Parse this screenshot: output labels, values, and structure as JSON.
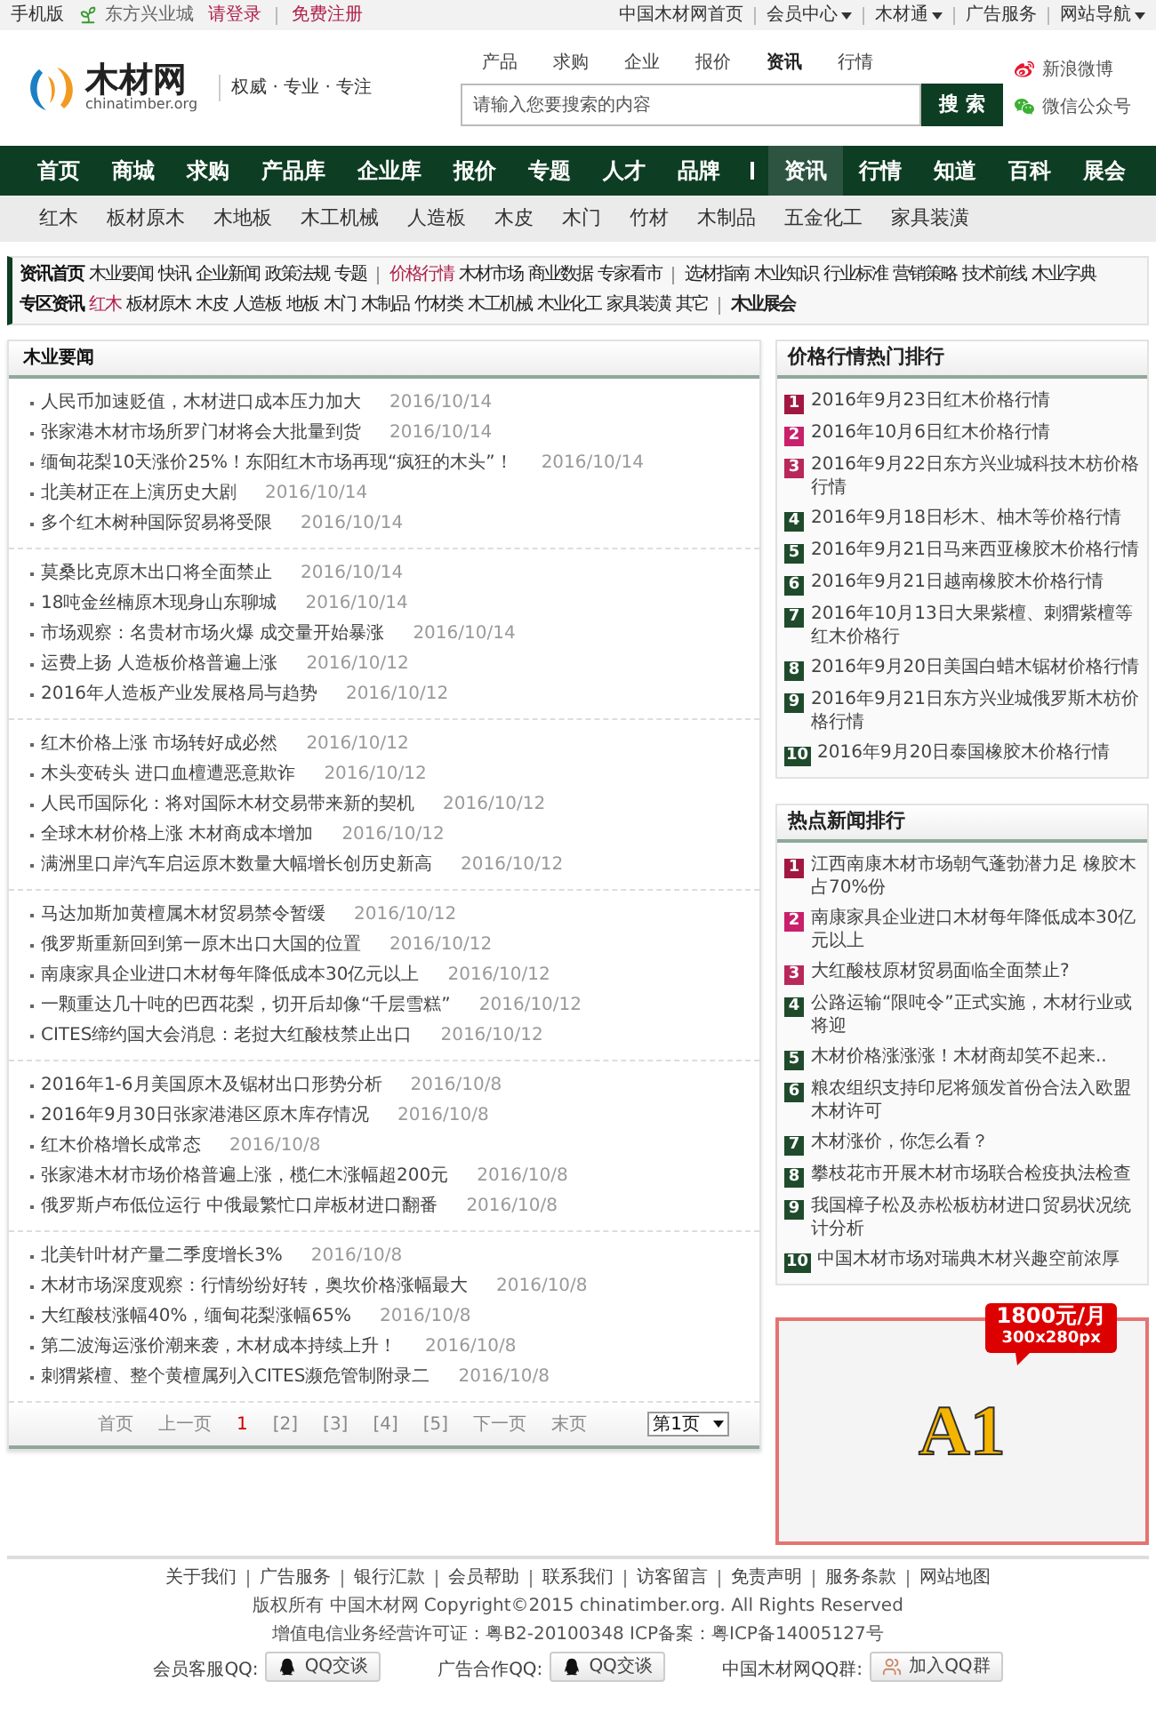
{
  "top_bar": {
    "mobile": "手机版",
    "store": "东方兴业城",
    "login": "请登录",
    "register": "免费注册",
    "links": [
      {
        "label": "中国木材网首页",
        "dropdown": false
      },
      {
        "label": "会员中心",
        "dropdown": true
      },
      {
        "label": "木材通",
        "dropdown": true
      },
      {
        "label": "广告服务",
        "dropdown": false
      },
      {
        "label": "网站导航",
        "dropdown": true
      }
    ]
  },
  "header": {
    "logo": {
      "name": "木材网",
      "domain": "chinatimber.org"
    },
    "slogan": "权威 · 专业 · 专注",
    "search_tabs": [
      {
        "label": "产品",
        "selected": false
      },
      {
        "label": "求购",
        "selected": false
      },
      {
        "label": "企业",
        "selected": false
      },
      {
        "label": "报价",
        "selected": false
      },
      {
        "label": "资讯",
        "selected": true
      },
      {
        "label": "行情",
        "selected": false
      }
    ],
    "search": {
      "placeholder": "请输入您要搜索的内容",
      "button": "搜 索"
    },
    "social": [
      {
        "kind": "weibo",
        "label": "新浪微博"
      },
      {
        "kind": "wechat",
        "label": "微信公众号"
      }
    ]
  },
  "main_nav": [
    {
      "kind": "link",
      "label": "首页",
      "selected": false
    },
    {
      "kind": "link",
      "label": "商城",
      "selected": false
    },
    {
      "kind": "link",
      "label": "求购",
      "selected": false
    },
    {
      "kind": "link",
      "label": "产品库",
      "selected": false
    },
    {
      "kind": "link",
      "label": "企业库",
      "selected": false
    },
    {
      "kind": "link",
      "label": "报价",
      "selected": false
    },
    {
      "kind": "link",
      "label": "专题",
      "selected": false
    },
    {
      "kind": "link",
      "label": "人才",
      "selected": false
    },
    {
      "kind": "link",
      "label": "品牌",
      "selected": false
    },
    {
      "kind": "divider"
    },
    {
      "kind": "link",
      "label": "资讯",
      "selected": true
    },
    {
      "kind": "link",
      "label": "行情",
      "selected": false
    },
    {
      "kind": "link",
      "label": "知道",
      "selected": false
    },
    {
      "kind": "link",
      "label": "百科",
      "selected": false
    },
    {
      "kind": "link",
      "label": "展会",
      "selected": false
    }
  ],
  "category_nav": [
    "红木",
    "板材原木",
    "木地板",
    "木工机械",
    "人造板",
    "木皮",
    "木门",
    "竹材",
    "木制品",
    "五金化工",
    "家具装潢"
  ],
  "channel_rows": [
    {
      "title": "资讯首页",
      "items": [
        {
          "kind": "link",
          "label": "木业要闻",
          "accent": false,
          "bold": false
        },
        {
          "kind": "link",
          "label": "快讯",
          "accent": false,
          "bold": false
        },
        {
          "kind": "link",
          "label": "企业新闻",
          "accent": false,
          "bold": false
        },
        {
          "kind": "link",
          "label": "政策法规",
          "accent": false,
          "bold": false
        },
        {
          "kind": "link",
          "label": "专题",
          "accent": false,
          "bold": false
        },
        {
          "kind": "divider"
        },
        {
          "kind": "link",
          "label": "价格行情",
          "accent": true,
          "bold": false
        },
        {
          "kind": "link",
          "label": "木材市场",
          "accent": false,
          "bold": false
        },
        {
          "kind": "link",
          "label": "商业数据",
          "accent": false,
          "bold": false
        },
        {
          "kind": "link",
          "label": "专家看市",
          "accent": false,
          "bold": false
        },
        {
          "kind": "divider"
        },
        {
          "kind": "link",
          "label": "选材指南",
          "accent": false,
          "bold": false
        },
        {
          "kind": "link",
          "label": "木业知识",
          "accent": false,
          "bold": false
        },
        {
          "kind": "link",
          "label": "行业标准",
          "accent": false,
          "bold": false
        },
        {
          "kind": "link",
          "label": "营销策略",
          "accent": false,
          "bold": false
        },
        {
          "kind": "link",
          "label": "技术前线",
          "accent": false,
          "bold": false
        },
        {
          "kind": "link",
          "label": "木业字典",
          "accent": false,
          "bold": false
        }
      ]
    },
    {
      "title": "专区资讯",
      "items": [
        {
          "kind": "link",
          "label": "红木",
          "accent": true,
          "bold": false
        },
        {
          "kind": "link",
          "label": "板材原木",
          "accent": false,
          "bold": false
        },
        {
          "kind": "link",
          "label": "木皮",
          "accent": false,
          "bold": false
        },
        {
          "kind": "link",
          "label": "人造板",
          "accent": false,
          "bold": false
        },
        {
          "kind": "link",
          "label": "地板",
          "accent": false,
          "bold": false
        },
        {
          "kind": "link",
          "label": "木门",
          "accent": false,
          "bold": false
        },
        {
          "kind": "link",
          "label": "木制品",
          "accent": false,
          "bold": false
        },
        {
          "kind": "link",
          "label": "竹材类",
          "accent": false,
          "bold": false
        },
        {
          "kind": "link",
          "label": "木工机械",
          "accent": false,
          "bold": false
        },
        {
          "kind": "link",
          "label": "木业化工",
          "accent": false,
          "bold": false
        },
        {
          "kind": "link",
          "label": "家具装潢",
          "accent": false,
          "bold": false
        },
        {
          "kind": "link",
          "label": "其它",
          "accent": false,
          "bold": false
        },
        {
          "kind": "divider"
        },
        {
          "kind": "link",
          "label": "木业展会",
          "accent": false,
          "bold": true
        }
      ]
    }
  ],
  "news": {
    "title": "木业要闻",
    "groups": [
      [
        {
          "title": "人民币加速贬值，木材进口成本压力加大",
          "date": "2016/10/14"
        },
        {
          "title": "张家港木材市场所罗门材将会大批量到货",
          "date": "2016/10/14"
        },
        {
          "title": "缅甸花梨10天涨价25%！东阳红木市场再现“疯狂的木头”！",
          "date": "2016/10/14"
        },
        {
          "title": "北美材正在上演历史大剧",
          "date": "2016/10/14"
        },
        {
          "title": "多个红木树种国际贸易将受限",
          "date": "2016/10/14"
        }
      ],
      [
        {
          "title": "莫桑比克原木出口将全面禁止",
          "date": "2016/10/14"
        },
        {
          "title": "18吨金丝楠原木现身山东聊城",
          "date": "2016/10/14"
        },
        {
          "title": "市场观察：名贵材市场火爆 成交量开始暴涨",
          "date": "2016/10/14"
        },
        {
          "title": "运费上扬 人造板价格普遍上涨",
          "date": "2016/10/12"
        },
        {
          "title": "2016年人造板产业发展格局与趋势",
          "date": "2016/10/12"
        }
      ],
      [
        {
          "title": "红木价格上涨 市场转好成必然",
          "date": "2016/10/12"
        },
        {
          "title": "木头变砖头 进口血檀遭恶意欺诈",
          "date": "2016/10/12"
        },
        {
          "title": "人民币国际化：将对国际木材交易带来新的契机",
          "date": "2016/10/12"
        },
        {
          "title": "全球木材价格上涨 木材商成本增加",
          "date": "2016/10/12"
        },
        {
          "title": "满洲里口岸汽车启运原木数量大幅增长创历史新高",
          "date": "2016/10/12"
        }
      ],
      [
        {
          "title": "马达加斯加黄檀属木材贸易禁令暂缓",
          "date": "2016/10/12"
        },
        {
          "title": "俄罗斯重新回到第一原木出口大国的位置",
          "date": "2016/10/12"
        },
        {
          "title": "南康家具企业进口木材每年降低成本30亿元以上",
          "date": "2016/10/12"
        },
        {
          "title": "一颗重达几十吨的巴西花梨，切开后却像“千层雪糕”",
          "date": "2016/10/12"
        },
        {
          "title": "CITES缔约国大会消息：老挝大红酸枝禁止出口",
          "date": "2016/10/12"
        }
      ],
      [
        {
          "title": "2016年1-6月美国原木及锯材出口形势分析",
          "date": "2016/10/8"
        },
        {
          "title": "2016年9月30日张家港港区原木库存情况",
          "date": "2016/10/8"
        },
        {
          "title": "红木价格增长成常态",
          "date": "2016/10/8"
        },
        {
          "title": "张家港木材市场价格普遍上涨，榄仁木涨幅超200元",
          "date": "2016/10/8"
        },
        {
          "title": "俄罗斯卢布低位运行 中俄最繁忙口岸板材进口翻番",
          "date": "2016/10/8"
        }
      ],
      [
        {
          "title": "北美针叶材产量二季度增长3%",
          "date": "2016/10/8"
        },
        {
          "title": "木材市场深度观察：行情纷纷好转，奥坎价格涨幅最大",
          "date": "2016/10/8"
        },
        {
          "title": "大红酸枝涨幅40%，缅甸花梨涨幅65%",
          "date": "2016/10/8"
        },
        {
          "title": "第二波海运涨价潮来袭，木材成本持续上升！",
          "date": "2016/10/8"
        },
        {
          "title": "刺猬紫檀、整个黄檀属列入CITES濒危管制附录二",
          "date": "2016/10/8"
        }
      ]
    ]
  },
  "pagination": {
    "items": [
      {
        "label": "首页",
        "selected": false
      },
      {
        "label": "上一页",
        "selected": false
      },
      {
        "label": "1",
        "selected": true
      },
      {
        "label": "[2]",
        "selected": false
      },
      {
        "label": "[3]",
        "selected": false
      },
      {
        "label": "[4]",
        "selected": false
      },
      {
        "label": "[5]",
        "selected": false
      },
      {
        "label": "下一页",
        "selected": false
      },
      {
        "label": "末页",
        "selected": false
      }
    ],
    "page_select": "第1页"
  },
  "rankings": [
    {
      "title": "价格行情热门排行",
      "items": [
        {
          "rank": "1",
          "color": "#a01840",
          "text": "2016年9月23日红木价格行情"
        },
        {
          "rank": "2",
          "color": "#c8206a",
          "text": "2016年10月6日红木价格行情"
        },
        {
          "rank": "3",
          "color": "#b8285a",
          "text": "2016年9月22日东方兴业城科技木枋价格行情"
        },
        {
          "rank": "4",
          "color": "#1f4a2c",
          "text": "2016年9月18日杉木、柚木等价格行情"
        },
        {
          "rank": "5",
          "color": "#1f4a2c",
          "text": "2016年9月21日马来西亚橡胶木价格行情"
        },
        {
          "rank": "6",
          "color": "#1f4a2c",
          "text": "2016年9月21日越南橡胶木价格行情"
        },
        {
          "rank": "7",
          "color": "#1f4a2c",
          "text": "2016年10月13日大果紫檀、刺猬紫檀等红木价格行"
        },
        {
          "rank": "8",
          "color": "#1f4a2c",
          "text": "2016年9月20日美国白蜡木锯材价格行情"
        },
        {
          "rank": "9",
          "color": "#1f4a2c",
          "text": "2016年9月21日东方兴业城俄罗斯木枋价格行情"
        },
        {
          "rank": "10",
          "color": "#1f4a2c",
          "text": "2016年9月20日泰国橡胶木价格行情"
        }
      ]
    },
    {
      "title": "热点新闻排行",
      "items": [
        {
          "rank": "1",
          "color": "#a01840",
          "text": "江西南康木材市场朝气蓬勃潜力足 橡胶木占70%份"
        },
        {
          "rank": "2",
          "color": "#c8206a",
          "text": "南康家具企业进口木材每年降低成本30亿元以上"
        },
        {
          "rank": "3",
          "color": "#b8285a",
          "text": "大红酸枝原材贸易面临全面禁止?"
        },
        {
          "rank": "4",
          "color": "#1f4a2c",
          "text": "公路运输“限吨令”正式实施，木材行业或将迎"
        },
        {
          "rank": "5",
          "color": "#1f4a2c",
          "text": "木材价格涨涨涨！木材商却笑不起来.."
        },
        {
          "rank": "6",
          "color": "#1f4a2c",
          "text": "粮农组织支持印尼将颁发首份合法入欧盟木材许可"
        },
        {
          "rank": "7",
          "color": "#1f4a2c",
          "text": "木材涨价，你怎么看？"
        },
        {
          "rank": "8",
          "color": "#1f4a2c",
          "text": "攀枝花市开展木材市场联合检疫执法检查"
        },
        {
          "rank": "9",
          "color": "#1f4a2c",
          "text": "我国樟子松及赤松板枋材进口贸易状况统计分析"
        },
        {
          "rank": "10",
          "color": "#1f4a2c",
          "text": "中国木材市场对瑞典木材兴趣空前浓厚"
        }
      ]
    }
  ],
  "ad": {
    "price": "1800元/月",
    "size": "300x280px",
    "label": "A1"
  },
  "footer": {
    "links": [
      "关于我们",
      "广告服务",
      "银行汇款",
      "会员帮助",
      "联系我们",
      "访客留言",
      "免责声明",
      "服务条款",
      "网站地图"
    ],
    "copyright": "版权所有 中国木材网 Copyright©2015 chinatimber.org. All Rights Reserved",
    "license": "增值电信业务经营许可证：粤B2-20100348 ICP备案：粤ICP备14005127号",
    "contacts": [
      {
        "label": "会员客服QQ:",
        "kind": "qq",
        "button": "QQ交谈"
      },
      {
        "label": "广告合作QQ:",
        "kind": "qq",
        "button": "QQ交谈"
      },
      {
        "label": "中国木材网QQ群:",
        "kind": "group",
        "button": "加入QQ群"
      }
    ]
  }
}
